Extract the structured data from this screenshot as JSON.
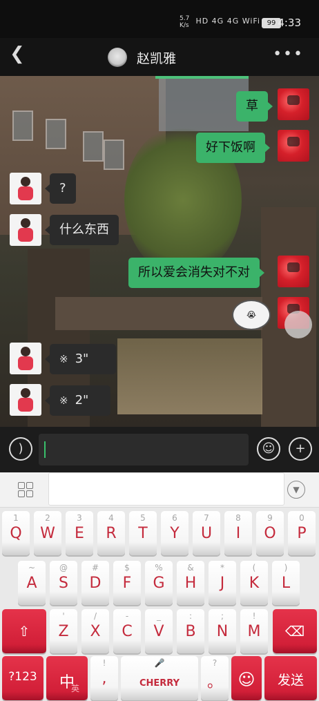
{
  "status_bar": {
    "signal_icons": "HD 4G 4G WiFi",
    "speed": "5.7 K/s",
    "battery": "99",
    "time": "4:33"
  },
  "header": {
    "back_icon": "back-arrow-icon",
    "title": "赵凯雅",
    "more_icon": "more-dots-icon"
  },
  "messages": [
    {
      "side": "right",
      "type": "text",
      "text": "草"
    },
    {
      "side": "right",
      "type": "text",
      "text": "好下饭啊"
    },
    {
      "side": "left",
      "type": "text",
      "text": "?"
    },
    {
      "side": "left",
      "type": "text",
      "text": "什么东西"
    },
    {
      "side": "right",
      "type": "text",
      "text": "所以爱会消失对不对"
    },
    {
      "side": "right",
      "type": "sticker",
      "text": ""
    },
    {
      "side": "left",
      "type": "voice",
      "text": "3\""
    },
    {
      "side": "left",
      "type": "voice",
      "text": "2\""
    }
  ],
  "input_bar": {
    "voice_icon": "voice-mode-icon",
    "emoji_icon": "emoji-icon",
    "plus_icon": "plus-icon"
  },
  "keyboard": {
    "row1": [
      {
        "k": "Q",
        "s": "1"
      },
      {
        "k": "W",
        "s": "2"
      },
      {
        "k": "E",
        "s": "3"
      },
      {
        "k": "R",
        "s": "4"
      },
      {
        "k": "T",
        "s": "5"
      },
      {
        "k": "Y",
        "s": "6"
      },
      {
        "k": "U",
        "s": "7"
      },
      {
        "k": "I",
        "s": "8"
      },
      {
        "k": "O",
        "s": "9"
      },
      {
        "k": "P",
        "s": "0"
      }
    ],
    "row2": [
      {
        "k": "A",
        "s": "~"
      },
      {
        "k": "S",
        "s": "@"
      },
      {
        "k": "D",
        "s": "#"
      },
      {
        "k": "F",
        "s": "$"
      },
      {
        "k": "G",
        "s": "%"
      },
      {
        "k": "H",
        "s": "&"
      },
      {
        "k": "J",
        "s": "*"
      },
      {
        "k": "K",
        "s": "("
      },
      {
        "k": "L",
        "s": ")"
      }
    ],
    "row3": [
      {
        "k": "Z",
        "s": "'"
      },
      {
        "k": "X",
        "s": "/"
      },
      {
        "k": "C",
        "s": "-"
      },
      {
        "k": "V",
        "s": "_"
      },
      {
        "k": "B",
        "s": ":"
      },
      {
        "k": "N",
        "s": ";"
      },
      {
        "k": "M",
        "s": "!"
      }
    ],
    "num_label": "?123",
    "lang_label": "中",
    "lang_sub": "英",
    "comma_label": ",",
    "comma_sub": "!",
    "space_label": "CHERRY",
    "period_label": "。",
    "period_sub": "?",
    "send_label": "发送"
  },
  "colors": {
    "accent": "#3bb36a",
    "key_red": "#d21f38",
    "key_text": "#c42a3c"
  }
}
